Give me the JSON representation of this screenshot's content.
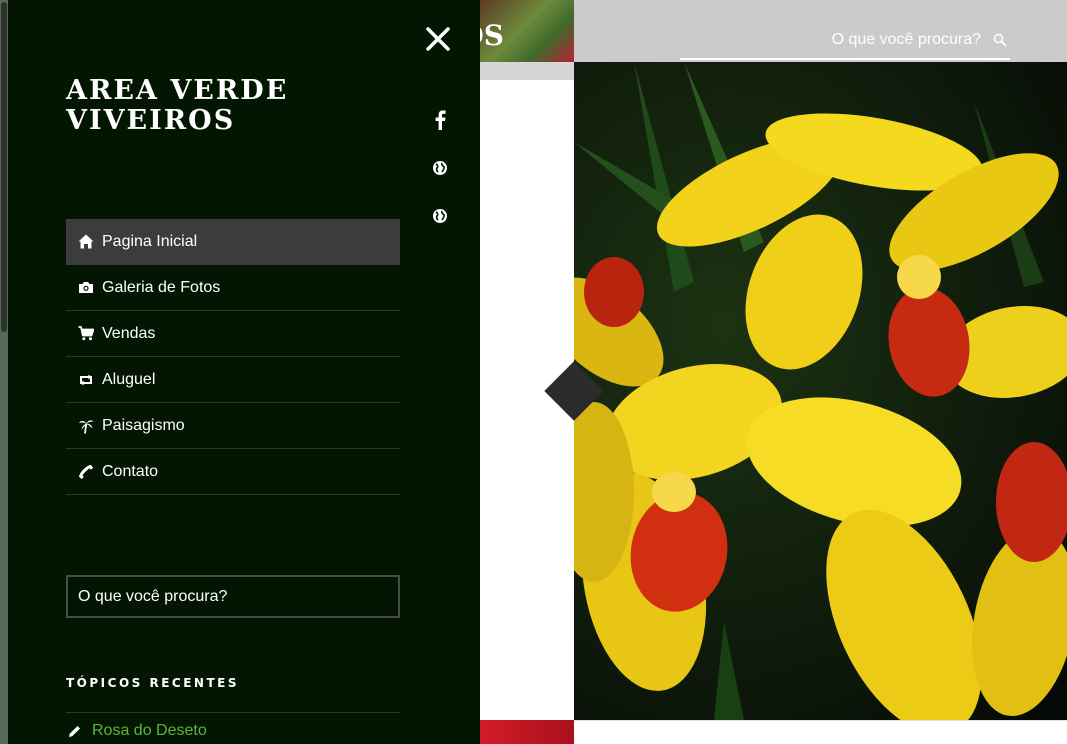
{
  "header": {
    "brand_fragment": "VIVEIROS",
    "search": {
      "placeholder": "O que você procura?",
      "icon": "search-icon"
    }
  },
  "drawer": {
    "title": "AREA VERDE VIVEIROS",
    "close_icon": "close-icon",
    "social": [
      {
        "name": "facebook-icon"
      },
      {
        "name": "globe-icon"
      },
      {
        "name": "globe-icon"
      }
    ],
    "menu": [
      {
        "label": "Pagina Inicial",
        "icon": "home-icon",
        "active": true
      },
      {
        "label": "Galeria de Fotos",
        "icon": "camera-icon",
        "active": false
      },
      {
        "label": "Vendas",
        "icon": "cart-icon",
        "active": false
      },
      {
        "label": "Aluguel",
        "icon": "retweet-icon",
        "active": false
      },
      {
        "label": "Paisagismo",
        "icon": "palm-tree-icon",
        "active": false
      },
      {
        "label": "Contato",
        "icon": "phone-icon",
        "active": false
      }
    ],
    "search": {
      "placeholder": "O que você procura?"
    },
    "recent": {
      "heading": "TÓPICOS RECENTES",
      "items": [
        {
          "label": "Rosa do Deseto",
          "icon": "pencil-icon"
        }
      ]
    }
  },
  "colors": {
    "drawer_bg": "#031602",
    "active_item_bg": "#3b3c3b",
    "link_green": "#5cb33a",
    "topbar_bg": "#cbcbcb"
  }
}
